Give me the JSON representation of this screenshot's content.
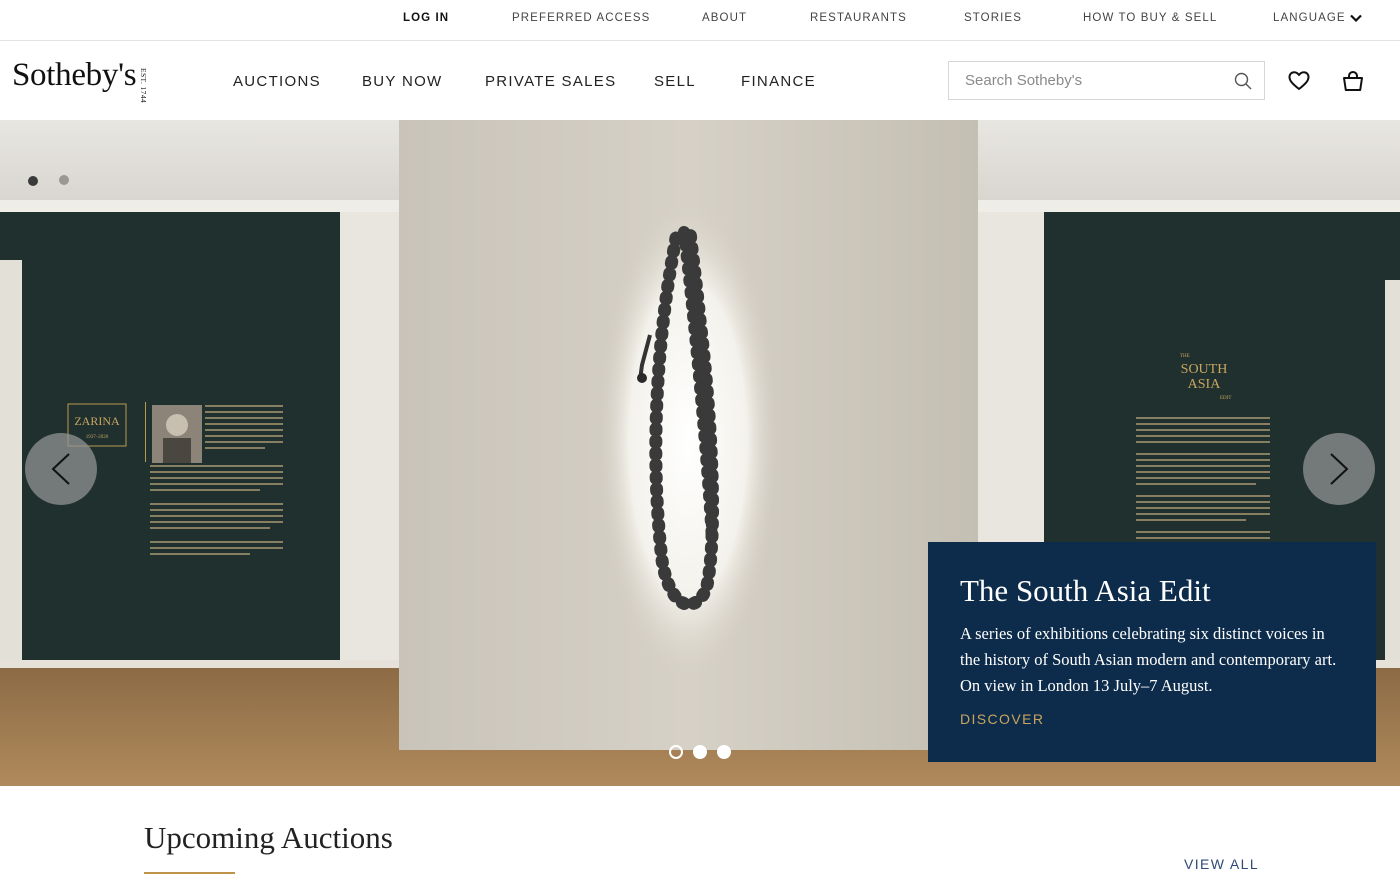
{
  "utility_nav": {
    "login": "LOG IN",
    "preferred_access": "PREFERRED ACCESS",
    "about": "ABOUT",
    "restaurants": "RESTAURANTS",
    "stories": "STORIES",
    "how_to_buy_sell": "HOW TO BUY & SELL",
    "language": "LANGUAGE",
    "language_icon": "chevron-down-icon"
  },
  "header": {
    "logo_text": "Sotheby's",
    "logo_est": "EST. 1744",
    "nav": {
      "auctions": "AUCTIONS",
      "buy_now": "BUY NOW",
      "private_sales": "PRIVATE SALES",
      "sell": "SELL",
      "finance": "FINANCE"
    },
    "search": {
      "placeholder": "Search Sotheby's",
      "value": "",
      "icon": "search-icon"
    },
    "icons": [
      "heart-icon",
      "shopping-bag-icon"
    ]
  },
  "hero": {
    "slide_count": 3,
    "active_slide": 1,
    "prev_icon": "chevron-left-icon",
    "next_icon": "chevron-right-icon",
    "promo": {
      "title": "The South Asia Edit",
      "text": "A series of exhibitions celebrating six distinct voices in the history of South Asian modern and contemporary art. On view in London 13 July–7 August.",
      "cta": "DISCOVER"
    },
    "wall_labels": {
      "left_panel_title": "ZARINA",
      "left_panel_dates": "1937–2020",
      "right_panel_kicker": "THE",
      "right_panel_title_line1": "SOUTH",
      "right_panel_title_line2": "ASIA",
      "right_panel_kicker_bottom": "EDIT"
    }
  },
  "upcoming": {
    "title": "Upcoming Auctions",
    "view_all": "VIEW ALL"
  },
  "colors": {
    "promo_bg": "#0d2b4a",
    "accent_gold": "#c9a660",
    "link_blue": "#2f4a78",
    "wall_dark": "#1d2d2c",
    "rule_gold": "#c0934a"
  }
}
